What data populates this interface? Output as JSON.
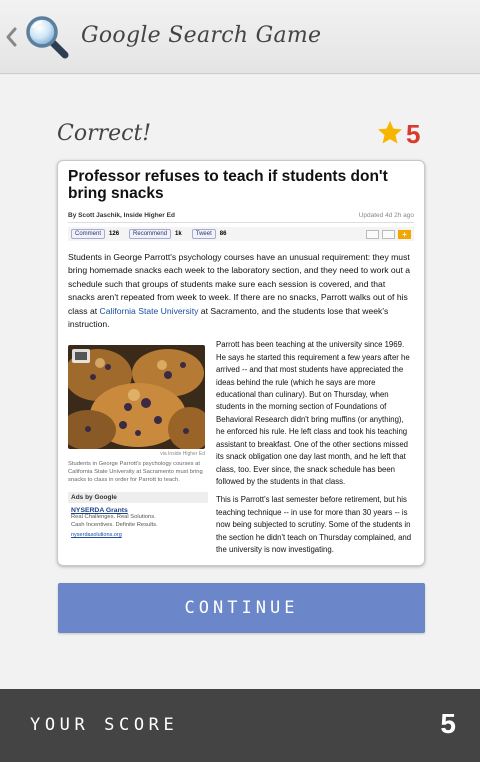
{
  "app": {
    "title": "Google Search Game"
  },
  "result": {
    "label": "Correct!",
    "stars": "5"
  },
  "article": {
    "headline": "Professor refuses to teach if students don't bring snacks",
    "byline": "By Scott Jaschik, Inside Higher Ed",
    "updated": "Updated 4d 2h ago",
    "social": {
      "comment_label": "Comment",
      "comment_count": "126",
      "recommend_label": "Recommend",
      "recommend_count": "1k",
      "tweet_label": "Tweet",
      "tweet_count": "86"
    },
    "lead_part1": "Students in George Parrott's psychology courses have an unusual requirement: they must bring homemade snacks each week to the laboratory section, and they need to work out a schedule such that groups of students make sure each session is covered, and that snacks aren't repeated from week to week. If there are no snacks, Parrott walks out of his class at ",
    "lead_link": "California State University",
    "lead_part2": " at Sacramento, and the students lose that week's instruction.",
    "photo_credit": "via Inside Higher Ed",
    "caption": "Students in George Parrott's psychology courses at California State University at Sacramento must bring snacks to class in order for Parrott to teach.",
    "ads": {
      "title": "Ads by Google",
      "link": "NYSERDA Grants",
      "line1": "Real Challenges. Real Solutions.",
      "line2": "Cash Incentives. Definite Results.",
      "url": "nyserdasolutions.org"
    },
    "para2": "Parrott has been teaching at the university since 1969. He says he started this requirement a few years after he arrived -- and that most students have appreciated the ideas behind the rule (which he says are more educational than culinary). But on Thursday, when students in the morning section of Foundations of Behavioral Research didn't bring muffins (or anything), he enforced his rule. He left class and took his teaching assistant to breakfast. One of the other sections missed its snack obligation one day last month, and he left that class, too. Ever since, the snack schedule has been followed by the students in that class.",
    "para3": "This is Parrott's last semester before retirement, but his teaching technique -- in use for more than 30 years -- is now being subjected to scrutiny. Some of the students in the section he didn't teach on Thursday complained, and the university is now investigating."
  },
  "continue_label": "CONTINUE",
  "score": {
    "label": "YOUR SCORE",
    "value": "5"
  },
  "colors": {
    "accent": "#6b87c9",
    "stars": "#d93a2b",
    "star_fill": "#f7b500",
    "bottom_bar": "#444444"
  },
  "icons": [
    "back-chevron-icon",
    "search-magnifier-icon",
    "star-icon"
  ]
}
